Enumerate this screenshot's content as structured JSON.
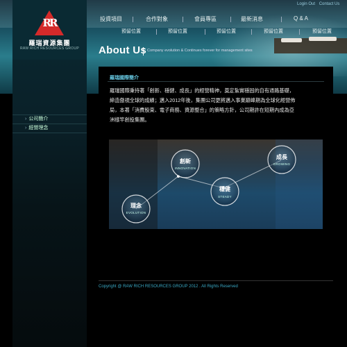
{
  "util_links": [
    "Login Out",
    "Contact Us"
  ],
  "logo": {
    "cn": "羅瑞資源集團",
    "en": "RAW RICH RESOURCES GROUP",
    "mark": "RR"
  },
  "nav": [
    "投資項目",
    "合作對象",
    "會員專區",
    "最新消息",
    "Q & A"
  ],
  "subnav": [
    "預留位置",
    "預留位置",
    "預留位置",
    "預留位置",
    "預留位置"
  ],
  "about": {
    "title": "About Us",
    "subtitle": "Company evolution & Continues forever for management sites"
  },
  "side_menu": [
    "公司簡介",
    "經營理念"
  ],
  "section": {
    "title": "羅瑞國際簡介",
    "paragraphs": [
      "羅瑞國際秉持著「創新、穩健、成長」的經營精神，奠定紮實穩固的自有通路基礎，",
      "締造傲視全球的成績；邁入2012年後，集團公司更將邁入事業巔峰期為全球化經營佈",
      "局，本著「消費股東、電子商務、資源整合」的策略方針，公司期許在短期內成為亞",
      "洲樣竿創投集團。"
    ]
  },
  "diagram": {
    "nodes": [
      {
        "cn": "創新",
        "en": "INNOVATION"
      },
      {
        "cn": "穩健",
        "en": "STEADY"
      },
      {
        "cn": "成長",
        "en": "GROWING"
      },
      {
        "cn": "理念",
        "en": "EVOLUTION"
      }
    ]
  },
  "footer": {
    "copyright": "Copyright @ RAW RICH RESOURCES GROUP 2012 . All Rights Reserved"
  }
}
